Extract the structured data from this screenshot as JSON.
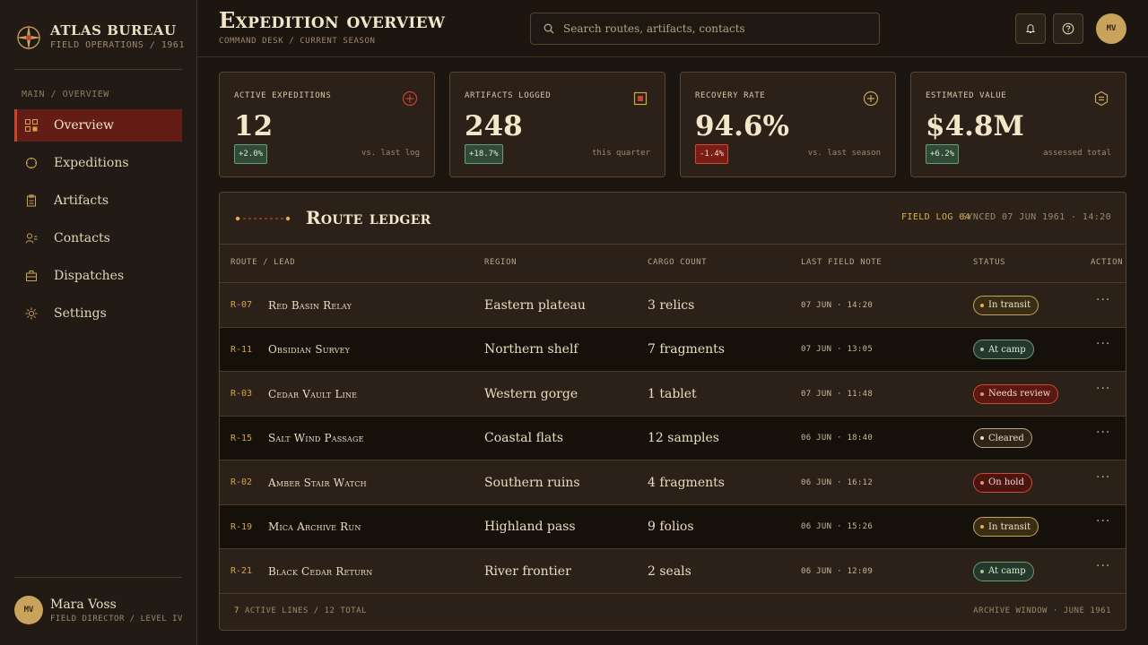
{
  "brand": {
    "title": "ATLAS BUREAU",
    "subtitle": "FIELD OPERATIONS / 1961"
  },
  "sidebar": {
    "section_label": "MAIN / OVERVIEW",
    "items": [
      {
        "label": "Overview",
        "icon": "grid-icon",
        "active": true
      },
      {
        "label": "Expeditions",
        "icon": "compass-icon"
      },
      {
        "label": "Artifacts",
        "icon": "clipboard-icon"
      },
      {
        "label": "Contacts",
        "icon": "users-icon"
      },
      {
        "label": "Dispatches",
        "icon": "briefcase-icon"
      },
      {
        "label": "Settings",
        "icon": "gear-icon"
      }
    ]
  },
  "user": {
    "initials": "MV",
    "name": "Mara Voss",
    "role": "FIELD DIRECTOR / LEVEL IV"
  },
  "header": {
    "title": "Expedition overview",
    "breadcrumb": "COMMAND DESK / CURRENT SEASON",
    "search_placeholder": "Search routes, artifacts, contacts",
    "avatar_initials": "MV"
  },
  "kpis": [
    {
      "label": "ACTIVE EXPEDITIONS",
      "value": "12",
      "delta": "+2.0%",
      "direction": "up",
      "note": "vs. last log",
      "icon": "crosshair-icon"
    },
    {
      "label": "ARTIFACTS LOGGED",
      "value": "248",
      "delta": "+18.7%",
      "direction": "up",
      "note": "this quarter",
      "icon": "box-icon"
    },
    {
      "label": "RECOVERY RATE",
      "value": "94.6%",
      "delta": "-1.4%",
      "direction": "down",
      "note": "vs. last season",
      "icon": "plus-circle-icon"
    },
    {
      "label": "ESTIMATED VALUE",
      "value": "$4.8M",
      "delta": "+6.2%",
      "direction": "up",
      "note": "assessed total",
      "icon": "hexagon-icon"
    }
  ],
  "ledger": {
    "title": "Route ledger",
    "field_log": "FIELD LOG 04",
    "synced": "SYNCED 07 JUN 1961 · 14:20",
    "columns": [
      "ROUTE / LEAD",
      "REGION",
      "CARGO COUNT",
      "LAST FIELD NOTE",
      "STATUS",
      "ACTION"
    ],
    "rows": [
      {
        "id": "R-07",
        "name": "Red Basin Relay",
        "region": "Eastern plateau",
        "cargo": "3 relics",
        "note": "07 JUN · 14:20",
        "status": "In transit",
        "status_type": "transit"
      },
      {
        "id": "R-11",
        "name": "Obsidian Survey",
        "region": "Northern shelf",
        "cargo": "7 fragments",
        "note": "07 JUN · 13:05",
        "status": "At camp",
        "status_type": "camp"
      },
      {
        "id": "R-03",
        "name": "Cedar Vault Line",
        "region": "Western gorge",
        "cargo": "1 tablet",
        "note": "07 JUN · 11:48",
        "status": "Needs review",
        "status_type": "review"
      },
      {
        "id": "R-15",
        "name": "Salt Wind Passage",
        "region": "Coastal flats",
        "cargo": "12 samples",
        "note": "06 JUN · 18:40",
        "status": "Cleared",
        "status_type": "cleared"
      },
      {
        "id": "R-02",
        "name": "Amber Stair Watch",
        "region": "Southern ruins",
        "cargo": "4 fragments",
        "note": "06 JUN · 16:12",
        "status": "On hold",
        "status_type": "hold"
      },
      {
        "id": "R-19",
        "name": "Mica Archive Run",
        "region": "Highland pass",
        "cargo": "9 folios",
        "note": "06 JUN · 15:26",
        "status": "In transit",
        "status_type": "transit"
      },
      {
        "id": "R-21",
        "name": "Black Cedar Return",
        "region": "River frontier",
        "cargo": "2 seals",
        "note": "06 JUN · 12:09",
        "status": "At camp",
        "status_type": "camp"
      }
    ],
    "row_action": "···",
    "footer_count": "7",
    "footer_left": "ACTIVE LINES / 12 TOTAL",
    "footer_right": "ARCHIVE WINDOW · JUNE 1961"
  },
  "colors": {
    "accent": "#c9432e",
    "gold": "#e0b04a",
    "background": "#1c1510",
    "panel": "#2b2118"
  }
}
